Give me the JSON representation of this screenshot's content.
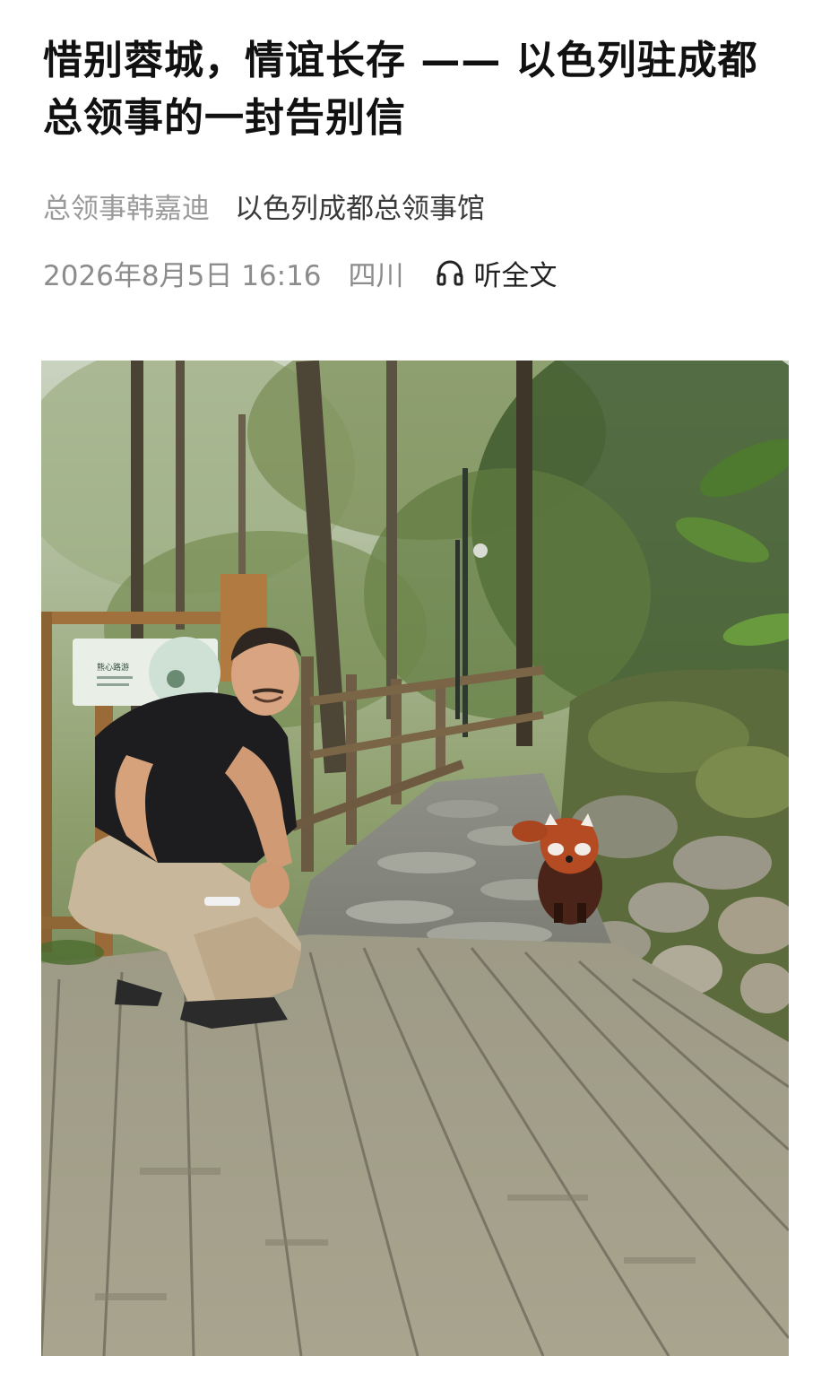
{
  "article": {
    "title": "惜别蓉城，情谊长存 —— 以色列驻成都总领事的一封告别信",
    "author": "总领事韩嘉迪",
    "organization": "以色列成都总领事馆",
    "datetime": "2026年8月5日 16:16",
    "region": "四川",
    "listen_label": "听全文",
    "listen_icon": "headphones-icon"
  },
  "photo": {
    "sign_text": "熊心路游"
  },
  "colors": {
    "title": "#111111",
    "meta": "#8c8c8c",
    "listen": "#222222"
  }
}
